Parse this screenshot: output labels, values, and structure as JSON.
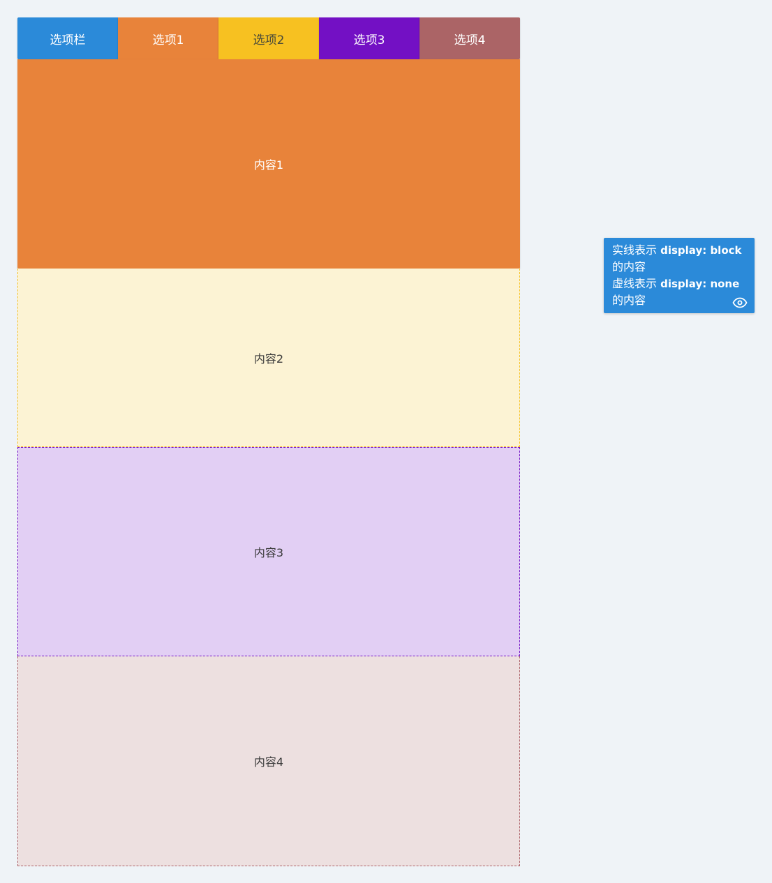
{
  "tabs": [
    {
      "label": "选项栏",
      "color": "#2b8ad9"
    },
    {
      "label": "选项1",
      "color": "#e8833a"
    },
    {
      "label": "选项2",
      "color": "#f7c121"
    },
    {
      "label": "选项3",
      "color": "#7310c4"
    },
    {
      "label": "选项4",
      "color": "#ab6466"
    }
  ],
  "panels": [
    {
      "label": "内容1",
      "style": "solid"
    },
    {
      "label": "内容2",
      "style": "dashed"
    },
    {
      "label": "内容3",
      "style": "dashed"
    },
    {
      "label": "内容4",
      "style": "dashed"
    }
  ],
  "legend": {
    "solid_prefix": "实线表示 ",
    "solid_code": "display: block",
    "solid_suffix": "的内容",
    "dashed_prefix": "虚线表示 ",
    "dashed_code": "display: none",
    "dashed_suffix": "的内容",
    "icon": "eye-icon"
  }
}
